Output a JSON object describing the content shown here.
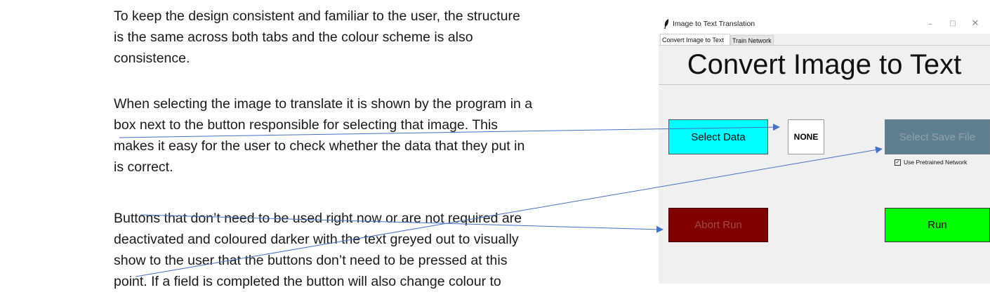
{
  "document": {
    "paragraphs": [
      [
        "To keep the design consistent and familiar to the user, the structure",
        "is the same across both tabs and the colour scheme is also",
        "consistence."
      ],
      [
        "When selecting the image to translate it is shown by the program in a",
        "box next to the button responsible for selecting that image. This",
        "makes it easy for the user to check whether the data that they put in",
        "is correct."
      ],
      [
        "Buttons that don’t need to be used right now or are not required are",
        "deactivated and coloured darker with the text greyed out to visually",
        "show to the user that the buttons don’t need to be pressed at this",
        "point. If a field is completed the button will also change colour to"
      ]
    ]
  },
  "window": {
    "title": "Image to Text Translation",
    "controls": {
      "minimize": "–",
      "maximize": "□",
      "close": "✕"
    },
    "icon": "feather-icon",
    "tabs": [
      "Convert Image to Text",
      "Train Network"
    ],
    "active_tab": "Convert Image to Text",
    "heading": "Convert Image to Text",
    "buttons": {
      "select_data": "Select Data",
      "data_preview": "NONE",
      "select_save": "Select Save File",
      "abort_run": "Abort Run",
      "run": "Run"
    },
    "checkbox": {
      "label": "Use Pretrained Network",
      "checked": true,
      "mark": "✓"
    },
    "colors": {
      "select_data": "#00ffff",
      "select_save_disabled": "#5f7f8f",
      "abort_disabled": "#800000",
      "run": "#00ff00",
      "arrow": "#4472c4"
    }
  }
}
